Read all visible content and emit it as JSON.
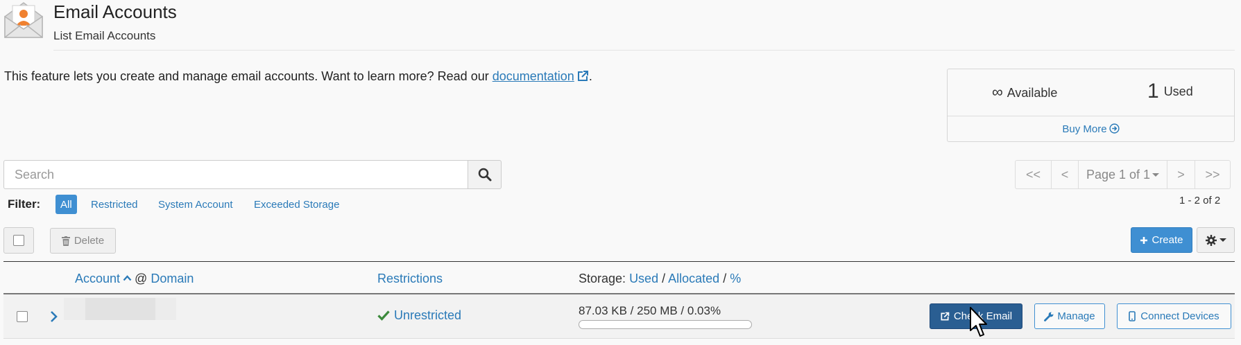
{
  "header": {
    "title": "Email Accounts",
    "subtitle": "List Email Accounts"
  },
  "intro": {
    "text": "This feature lets you create and manage email accounts. Want to learn more? Read our ",
    "link": "documentation",
    "suffix": "."
  },
  "stats": {
    "available_symbol": "∞",
    "available_label": "Available",
    "used_count": "1",
    "used_label": "Used",
    "buy_more": "Buy More"
  },
  "search": {
    "placeholder": "Search"
  },
  "pagination": {
    "first": "<<",
    "prev": "<",
    "page_label": "Page 1 of 1",
    "next": ">",
    "last": ">>",
    "result_count": "1 - 2 of 2"
  },
  "filter": {
    "label": "Filter:",
    "options": [
      "All",
      "Restricted",
      "System Account",
      "Exceeded Storage"
    ],
    "active": "All"
  },
  "toolbar": {
    "delete": "Delete",
    "create": "Create"
  },
  "table": {
    "columns": {
      "account": "Account",
      "at": "@",
      "domain": "Domain",
      "restrictions": "Restrictions",
      "storage_prefix": "Storage:",
      "storage_used": "Used",
      "storage_sep1": "/",
      "storage_allocated": "Allocated",
      "storage_sep2": "/",
      "storage_pct": "%"
    },
    "rows": [
      {
        "restriction": "Unrestricted",
        "storage": "87.03 KB / 250 MB / 0.03%",
        "storage_fraction": 0.0003,
        "actions": {
          "check_email": "Check Email",
          "manage": "Manage",
          "connect_devices": "Connect Devices"
        }
      }
    ]
  },
  "colors": {
    "primary": "#3f8fd2",
    "link": "#2a7ab8",
    "check_email_bg": "#2a5e92",
    "success": "#3c8a3c",
    "icon_orange": "#f08130"
  }
}
